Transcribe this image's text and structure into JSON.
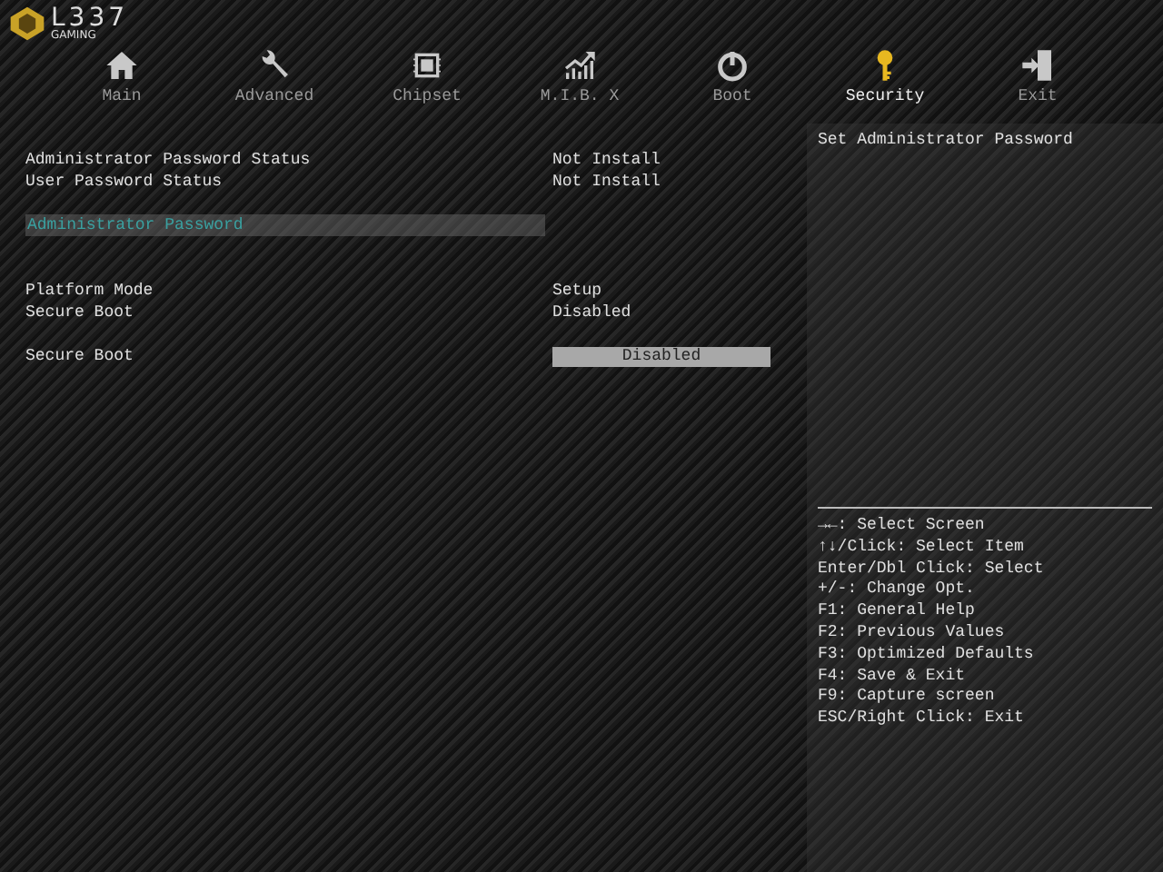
{
  "logo": {
    "brand": "L337",
    "subtitle": "GAMING"
  },
  "tabs": [
    {
      "label": "Main",
      "kind": "house",
      "selected": false
    },
    {
      "label": "Advanced",
      "kind": "wrench",
      "selected": false
    },
    {
      "label": "Chipset",
      "kind": "chip",
      "selected": false
    },
    {
      "label": "M.I.B. X",
      "kind": "chart",
      "selected": false
    },
    {
      "label": "Boot",
      "kind": "power",
      "selected": false
    },
    {
      "label": "Security",
      "kind": "key",
      "selected": true
    },
    {
      "label": "Exit",
      "kind": "exit",
      "selected": false
    }
  ],
  "settings": [
    {
      "kind": "info",
      "label": "Administrator Password Status",
      "value": "Not Install"
    },
    {
      "kind": "info",
      "label": "User Password Status",
      "value": "Not Install"
    },
    {
      "kind": "gap"
    },
    {
      "kind": "link",
      "label": "Administrator Password",
      "selected": true
    },
    {
      "kind": "gap"
    },
    {
      "kind": "gap"
    },
    {
      "kind": "info",
      "label": "Platform Mode",
      "value": "Setup"
    },
    {
      "kind": "info",
      "label": "Secure Boot",
      "value": "Disabled"
    },
    {
      "kind": "gap"
    },
    {
      "kind": "option",
      "label": "Secure Boot",
      "value": "Disabled"
    }
  ],
  "help_panel": {
    "description": "Set Administrator Password",
    "keys": [
      "→←: Select Screen",
      "↑↓/Click: Select Item",
      "Enter/Dbl Click: Select",
      "+/-: Change Opt.",
      "F1: General Help",
      "F2: Previous Values",
      "F3: Optimized Defaults",
      "F4: Save & Exit",
      "F9: Capture screen",
      "ESC/Right Click: Exit"
    ]
  }
}
